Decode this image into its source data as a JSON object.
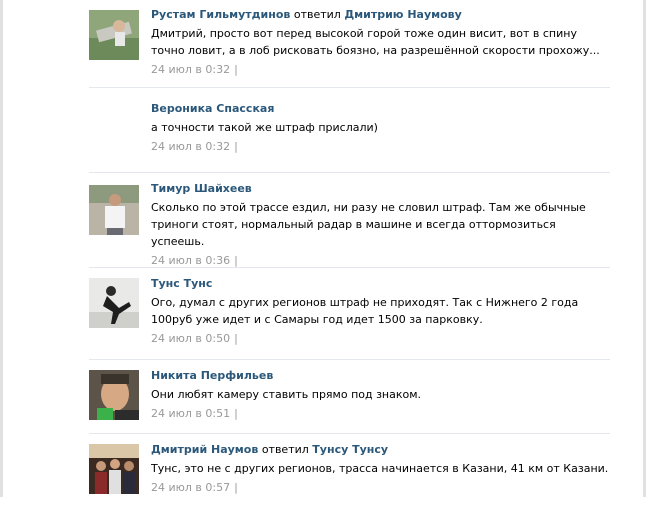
{
  "comments": [
    {
      "author": "Рустам Гильмутдинов",
      "action": "ответил",
      "reply_to": "Дмитрию Наумову",
      "text": "Дмитрий, просто вот перед высокой горой тоже один висит, вот в спину точно ловит, а в лоб рисковать боязно, на разрешённой скорости прохожу...",
      "date": "24 июл в 0:32",
      "separator": "|",
      "has_avatar": true
    },
    {
      "author": "Вероника Спасская",
      "action": "",
      "reply_to": "",
      "text": "а точности такой же штраф прислали)",
      "date": "24 июл в 0:32",
      "separator": "|",
      "has_avatar": false
    },
    {
      "author": "Тимур Шайхеев",
      "action": "",
      "reply_to": "",
      "text": "Сколько по этой трассе ездил, ни разу не словил штраф. Там же обычные триноги стоят, нормальный радар в машине и всегда оттормозиться успеешь.",
      "date": "24 июл в 0:36",
      "separator": "|",
      "has_avatar": true
    },
    {
      "author": "Тунс Тунс",
      "action": "",
      "reply_to": "",
      "text": "Ого, думал с других регионов штраф не приходят. Так с Нижнего 2 года 100руб уже идет и с Самары год идет 1500 за парковку.",
      "date": "24 июл в 0:50",
      "separator": "|",
      "has_avatar": true
    },
    {
      "author": "Никита Перфильев",
      "action": "",
      "reply_to": "",
      "text": "Они любят камеру ставить прямо под знаком.",
      "date": "24 июл в 0:51",
      "separator": "|",
      "has_avatar": true
    },
    {
      "author": "Дмитрий Наумов",
      "action": "ответил",
      "reply_to": "Тунсу Тунсу",
      "text": "Тунс, это не с других регионов, трасса начинается в Казани, 41 км от Казани.",
      "date": "24 июл в 0:57",
      "separator": "|",
      "has_avatar": true
    }
  ],
  "colors": {
    "link": "#2b587a",
    "meta": "#999999",
    "divider": "#e4e8ed"
  }
}
